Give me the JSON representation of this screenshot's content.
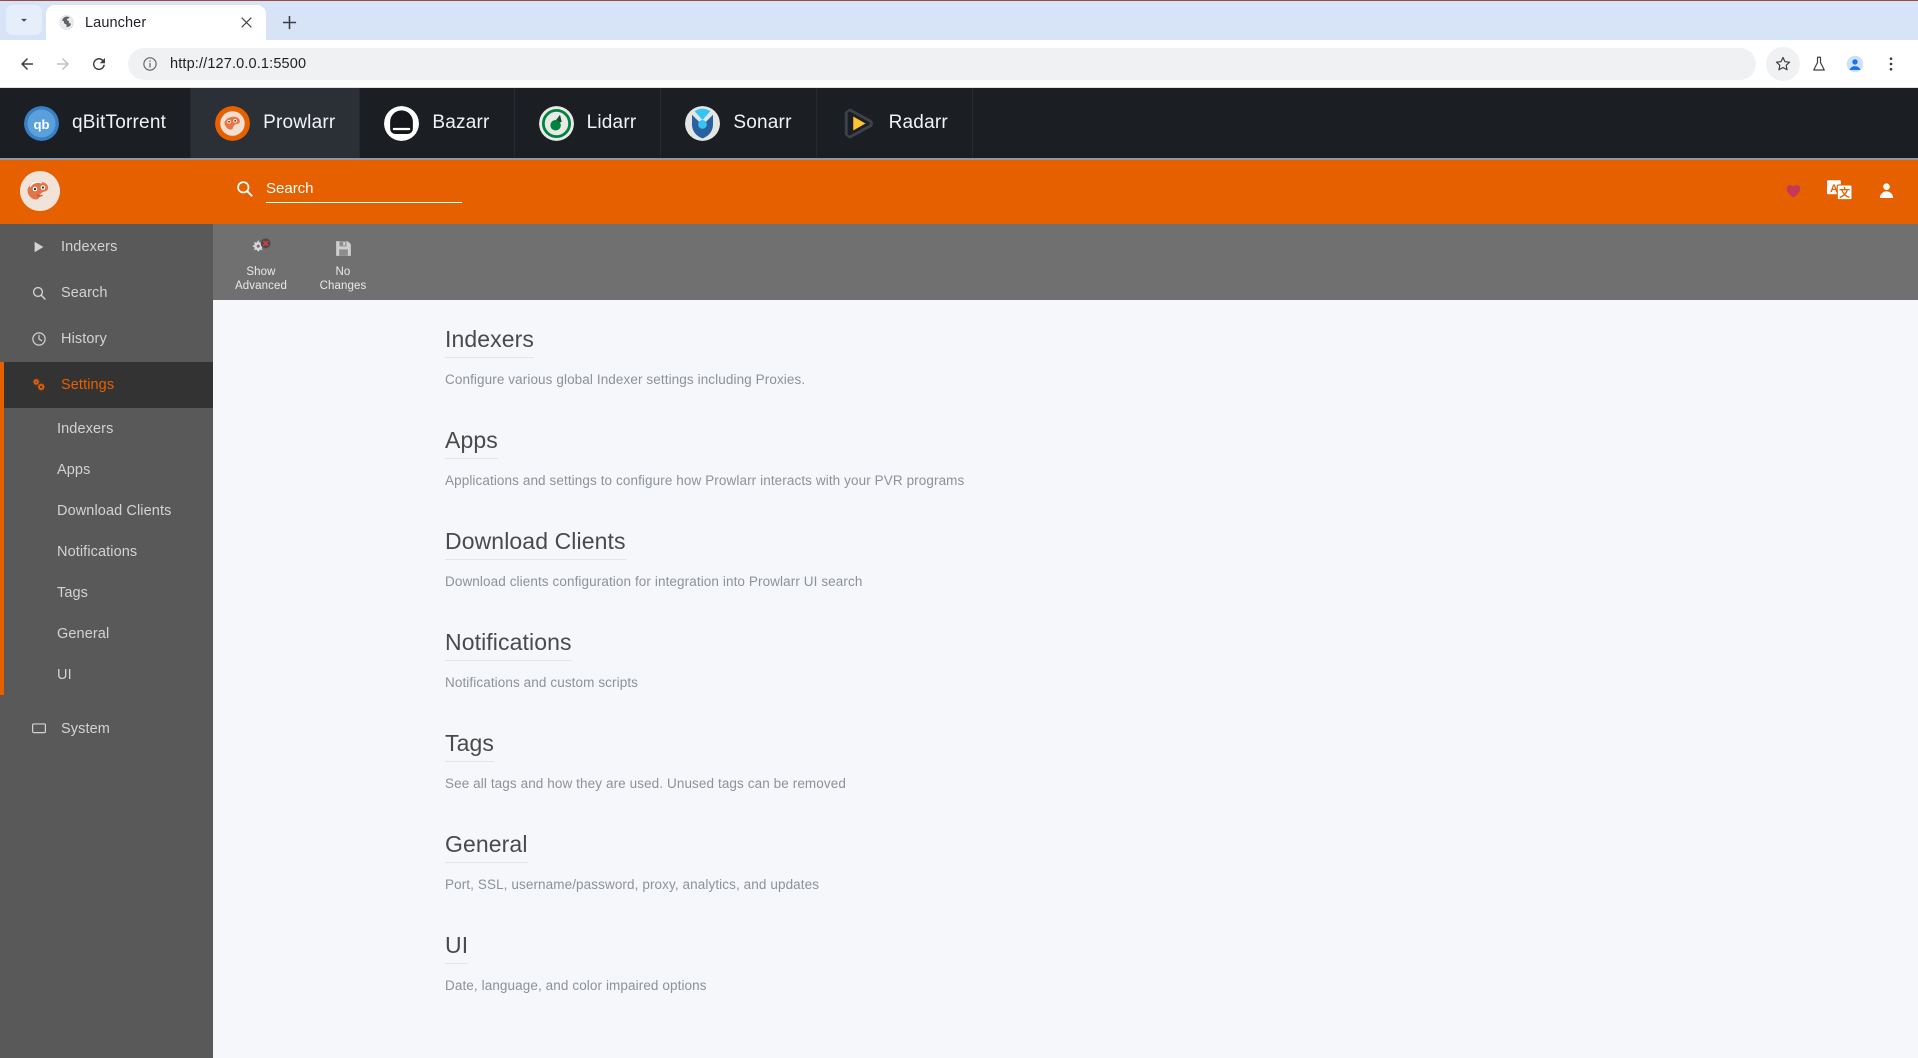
{
  "browser": {
    "tab": {
      "title": "Launcher",
      "favicon": "globe-icon"
    },
    "new_tab_label": "+",
    "nav": {
      "back": "back-arrow-icon",
      "forward": "forward-arrow-icon",
      "reload": "reload-icon"
    },
    "omnibox": {
      "url": "http://127.0.0.1:5500",
      "info_icon": "info-circle-icon"
    },
    "right_icons": [
      "bookmark-star-icon",
      "experiments-flask-icon",
      "profile-avatar-icon",
      "three-dot-menu-icon"
    ]
  },
  "launcher": {
    "items": [
      {
        "label": "qBitTorrent",
        "icon": "qbittorrent-icon",
        "active": false
      },
      {
        "label": "Prowlarr",
        "icon": "prowlarr-icon",
        "active": true
      },
      {
        "label": "Bazarr",
        "icon": "bazarr-icon",
        "active": false
      },
      {
        "label": "Lidarr",
        "icon": "lidarr-icon",
        "active": false
      },
      {
        "label": "Sonarr",
        "icon": "sonarr-icon",
        "active": false
      },
      {
        "label": "Radarr",
        "icon": "radarr-icon",
        "active": false
      }
    ]
  },
  "app_header": {
    "brand": "prowlarr-logo",
    "search_placeholder": "Search",
    "search_value": "",
    "icons": [
      {
        "name": "donate-heart-icon",
        "color": "#c4395a"
      },
      {
        "name": "translate-icon",
        "color": "#ffffff"
      },
      {
        "name": "account-icon",
        "color": "#ffffff"
      }
    ]
  },
  "sidebar": {
    "items": [
      {
        "label": "Indexers",
        "icon": "play-triangle-icon",
        "active": false
      },
      {
        "label": "Search",
        "icon": "search-icon",
        "active": false
      },
      {
        "label": "History",
        "icon": "clock-icon",
        "active": false
      },
      {
        "label": "Settings",
        "icon": "cogs-icon",
        "active": true
      },
      {
        "label": "System",
        "icon": "monitor-icon",
        "active": false
      }
    ],
    "settings_children": [
      {
        "label": "Indexers"
      },
      {
        "label": "Apps"
      },
      {
        "label": "Download Clients"
      },
      {
        "label": "Notifications"
      },
      {
        "label": "Tags"
      },
      {
        "label": "General"
      },
      {
        "label": "UI"
      }
    ]
  },
  "page_toolbar": {
    "buttons": [
      {
        "label": "Show\nAdvanced",
        "line1": "Show",
        "line2": "Advanced",
        "icon": "advanced-settings-off-icon"
      },
      {
        "label": "No\nChanges",
        "line1": "No",
        "line2": "Changes",
        "icon": "save-disk-icon"
      }
    ]
  },
  "settings": {
    "sections": [
      {
        "title": "Indexers",
        "description": "Configure various global Indexer settings including Proxies."
      },
      {
        "title": "Apps",
        "description": "Applications and settings to configure how Prowlarr interacts with your PVR programs"
      },
      {
        "title": "Download Clients",
        "description": "Download clients configuration for integration into Prowlarr UI search"
      },
      {
        "title": "Notifications",
        "description": "Notifications and custom scripts"
      },
      {
        "title": "Tags",
        "description": "See all tags and how they are used. Unused tags can be removed"
      },
      {
        "title": "General",
        "description": "Port, SSL, username/password, proxy, analytics, and updates"
      },
      {
        "title": "UI",
        "description": "Date, language, and color impaired options"
      }
    ]
  },
  "colors": {
    "accent_orange": "#e66000",
    "launcher_bg": "#1b1e23",
    "sidebar_bg": "#595959",
    "sidebar_active_bg": "#333333",
    "toolbar_bg": "#707070",
    "content_bg": "#f5f7fa"
  }
}
